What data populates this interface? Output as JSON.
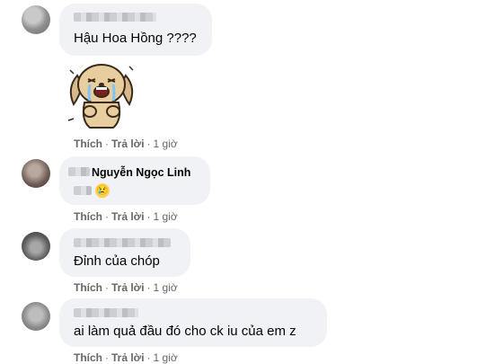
{
  "comments": [
    {
      "text": "Hậu Hoa Hồng ????",
      "actions": {
        "like": "Thích",
        "reply": "Trả lời",
        "time": "1 giờ"
      }
    },
    {
      "author": "Nguyễn Ngọc Linh",
      "emoji": "😢",
      "actions": {
        "like": "Thích",
        "reply": "Trả lời",
        "time": "1 giờ"
      }
    },
    {
      "text": "Đỉnh của chóp",
      "actions": {
        "like": "Thích",
        "reply": "Trả lời",
        "time": "1 giờ"
      }
    },
    {
      "text": "ai làm quả đầu đó cho ck iu của em z",
      "actions": {
        "like": "Thích",
        "reply": "Trả lời",
        "time": "1 giờ"
      }
    }
  ],
  "separator": "·",
  "colors": {
    "bubble": "#f0f2f5",
    "text": "#050505",
    "meta": "#65676b"
  },
  "icons": [
    "crying-dog-sticker",
    "crying-face-emoji"
  ]
}
